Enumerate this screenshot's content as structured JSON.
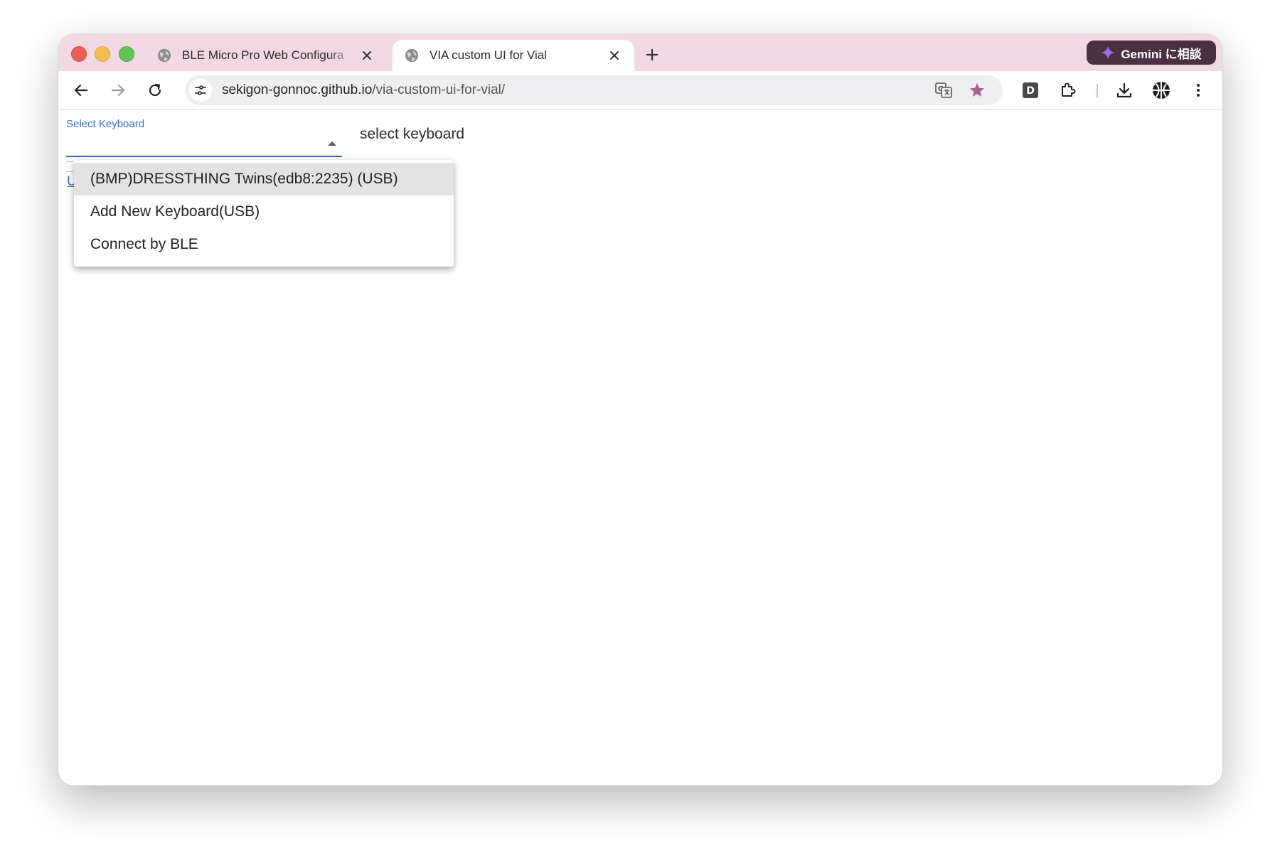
{
  "browser": {
    "tabs": [
      {
        "title": "BLE Micro Pro Web Configura",
        "active": false
      },
      {
        "title": "VIA custom UI for Vial",
        "active": true
      }
    ],
    "gemini_label": "Gemini に相談",
    "url": {
      "host": "sekigon-gonnoc.github.io",
      "path": "/via-custom-ui-for-vial/"
    },
    "colors": {
      "tabstrip": "#f2d8e3",
      "gemini_bg": "#4a3140",
      "bookmark_star": "#a8648a"
    }
  },
  "page": {
    "select": {
      "label": "Select Keyboard",
      "accent": "#3b6fc4"
    },
    "status_text": "select keyboard",
    "underlay_link_initial": "U",
    "menu": {
      "items": [
        {
          "label": "(BMP)DRESSTHING Twins(edb8:2235) (USB)",
          "selected": true
        },
        {
          "label": "Add New Keyboard(USB)",
          "selected": false
        },
        {
          "label": "Connect by BLE",
          "selected": false
        }
      ]
    }
  }
}
